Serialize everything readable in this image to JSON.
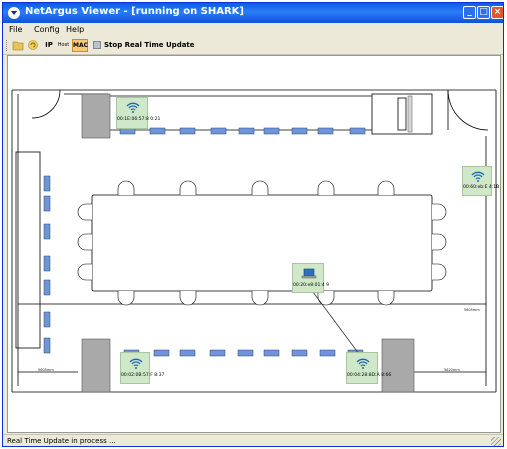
{
  "window": {
    "title": "NetArgus Viewer - [running on SHARK]"
  },
  "menu": {
    "items": [
      "File",
      "Config",
      "Help"
    ]
  },
  "toolbar": {
    "ip_label": "IP",
    "host_label": "Host",
    "mac_label": "MAC",
    "stop_label": "Stop Real Time Update"
  },
  "floorplan": {
    "access_points": [
      {
        "label": "00:1E:06:57:8 0:21"
      },
      {
        "label": "00:60:eb:E 4:1B"
      },
      {
        "label": "00:20:e8:01:4 9"
      },
      {
        "label": "00:02:0B:57:F 8:37"
      },
      {
        "label": "00:04:28:8D:A 8:66"
      }
    ],
    "scale_labels": [
      "5605mm",
      "5605mm",
      "5620mm"
    ]
  },
  "status": {
    "text": "Real Time Update in process ..."
  },
  "colors": {
    "titlebar": "#0a5ee0",
    "chrome": "#ece9d8",
    "seat": "#6f95d6",
    "ap_fill": "#cfe8c8"
  }
}
